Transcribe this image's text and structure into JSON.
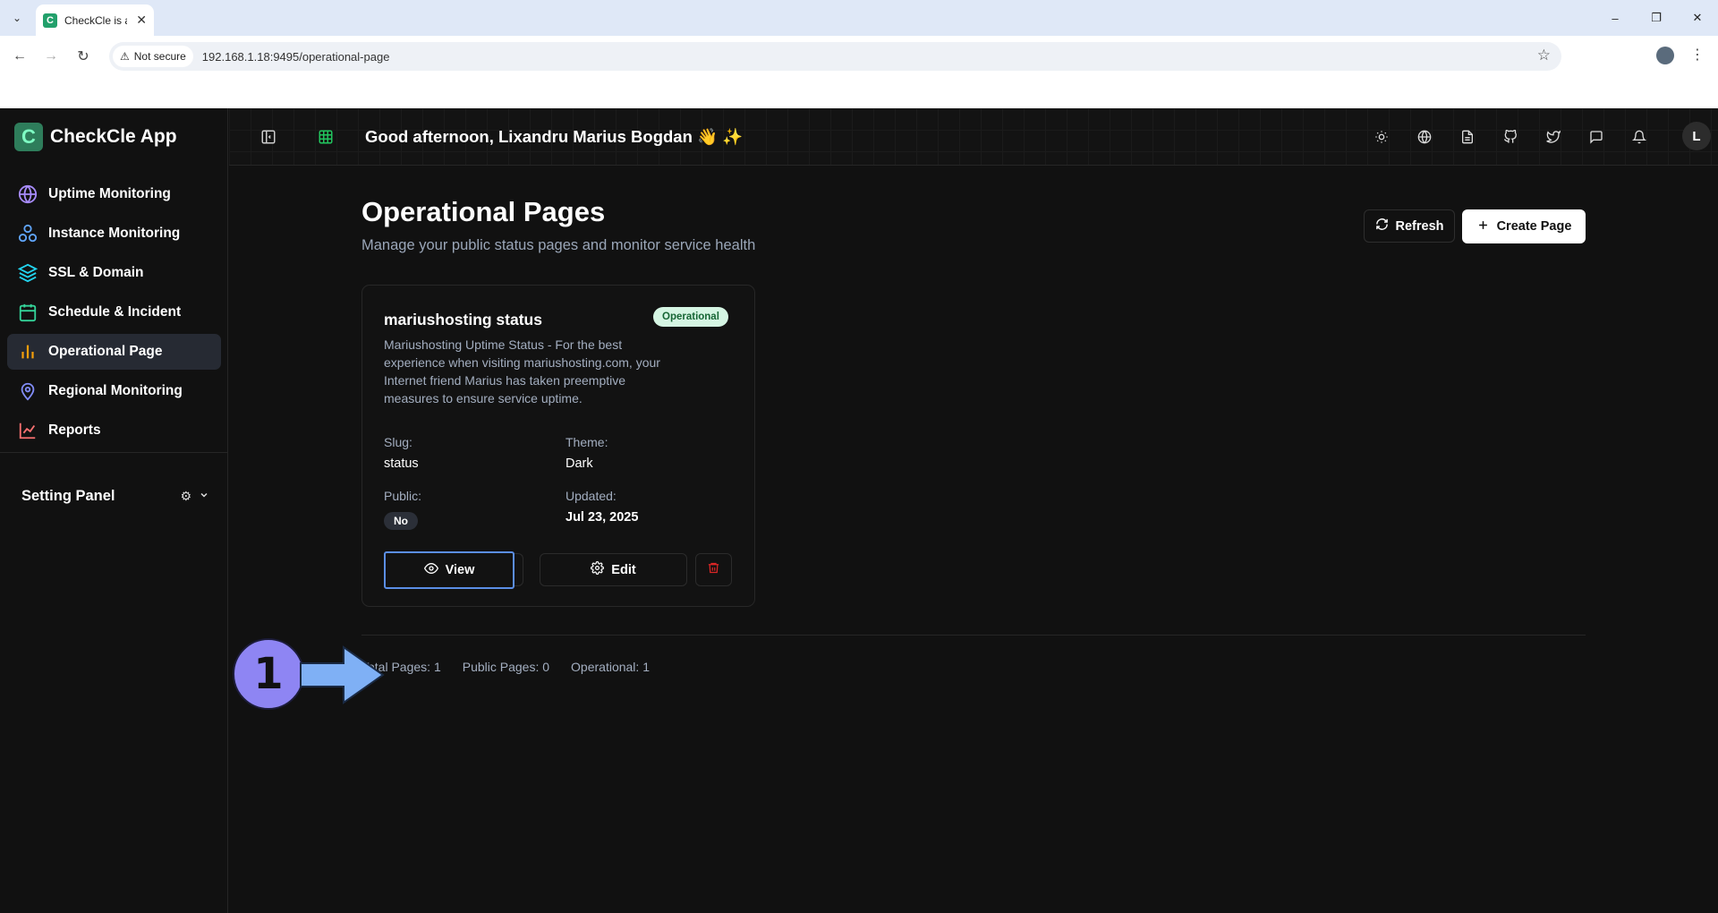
{
  "browser": {
    "tab_title": "CheckCle is a",
    "security_label": "Not secure",
    "url": "192.168.1.18:9495/operational-page"
  },
  "app": {
    "brand": "CheckCle App",
    "greeting": "Good afternoon, Lixandru Marius Bogdan 👋 ✨",
    "user_initial": "L"
  },
  "sidebar": {
    "items": [
      {
        "label": "Uptime Monitoring",
        "icon": "globe-icon",
        "color": "#a78bfa"
      },
      {
        "label": "Instance Monitoring",
        "icon": "boxes-icon",
        "color": "#60a5fa"
      },
      {
        "label": "SSL & Domain",
        "icon": "layers-icon",
        "color": "#22d3ee"
      },
      {
        "label": "Schedule & Incident",
        "icon": "calendar-icon",
        "color": "#34d399"
      },
      {
        "label": "Operational Page",
        "icon": "bar-chart-icon",
        "color": "#f59e0b"
      },
      {
        "label": "Regional Monitoring",
        "icon": "map-pin-icon",
        "color": "#818cf8"
      },
      {
        "label": "Reports",
        "icon": "line-chart-icon",
        "color": "#f87171"
      }
    ],
    "active_index": 4,
    "setting_panel": "Setting Panel"
  },
  "main": {
    "title": "Operational Pages",
    "subtitle": "Manage your public status pages and monitor service health",
    "refresh_label": "Refresh",
    "create_label": "Create Page"
  },
  "card": {
    "title": "mariushosting status",
    "status": "Operational",
    "description": "Mariushosting Uptime Status - For the best experience when visiting mariushosting.com, your Internet friend Marius has taken preemptive measures to ensure service uptime.",
    "slug_label": "Slug:",
    "slug_value": "status",
    "theme_label": "Theme:",
    "theme_value": "Dark",
    "public_label": "Public:",
    "public_value": "No",
    "updated_label": "Updated:",
    "updated_value": "Jul 23, 2025",
    "view_label": "View",
    "edit_label": "Edit"
  },
  "stats": {
    "total": "Total Pages: 1",
    "public": "Public Pages: 0",
    "operational": "Operational: 1"
  },
  "callout": {
    "number": "1",
    "color": "#8e85f3",
    "arrow_color": "#7fb0f5"
  }
}
